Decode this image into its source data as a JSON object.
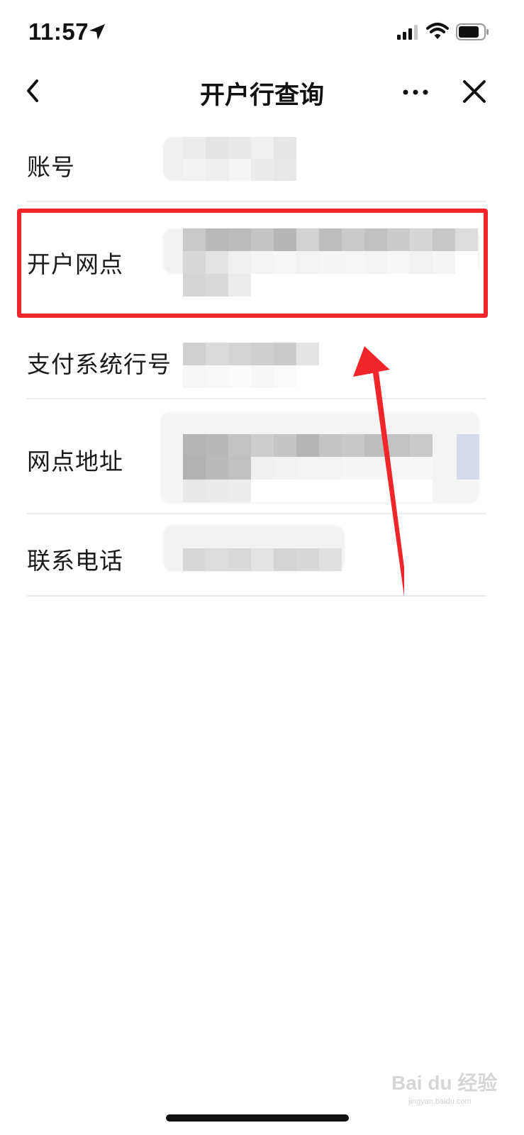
{
  "status_bar": {
    "time": "11:57",
    "icons": [
      "location-arrow-icon",
      "cellular-signal-icon",
      "wifi-icon",
      "battery-icon"
    ]
  },
  "nav": {
    "title": "开户行查询",
    "back_icon": "chevron-left-icon",
    "more_icon": "more-dots-icon",
    "close_icon": "close-icon"
  },
  "rows": [
    {
      "label": "账号",
      "value_redacted": true
    },
    {
      "label": "开户网点",
      "value_redacted": true
    },
    {
      "label": "支付系统行号",
      "value_redacted": true
    },
    {
      "label": "网点地址",
      "value_redacted": true
    },
    {
      "label": "联系电话",
      "value_redacted": true
    }
  ],
  "annotation": {
    "highlight_color": "#f0262a",
    "arrow_color": "#f0262a"
  },
  "watermark": {
    "brand": "Bai du 经验",
    "url": "jingyan.baidu.com"
  }
}
